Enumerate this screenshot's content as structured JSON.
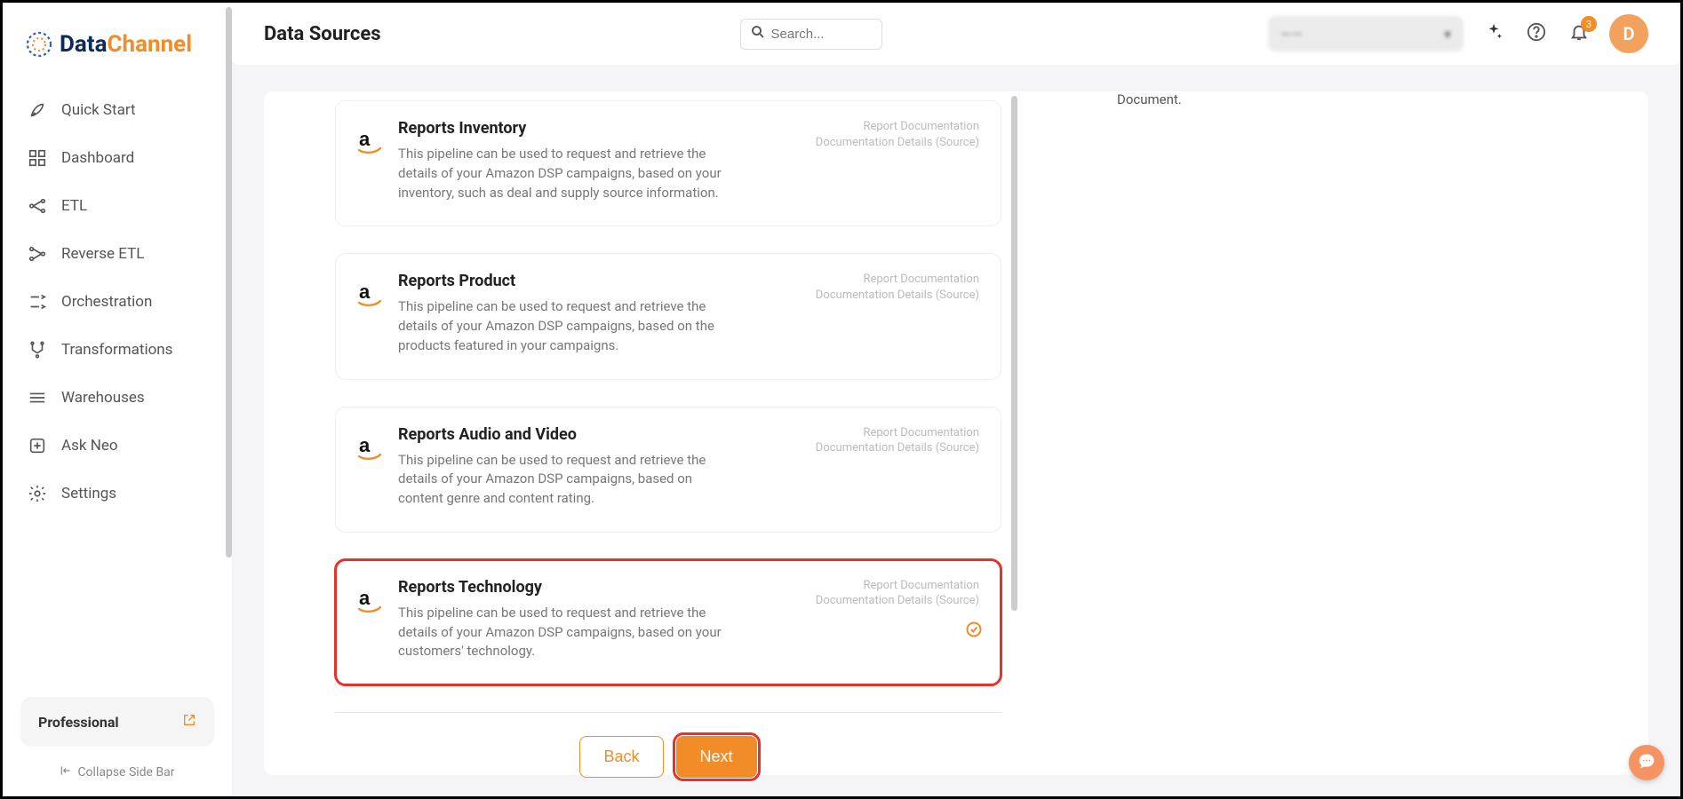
{
  "brand": {
    "data": "Data",
    "channel": "Channel"
  },
  "sidebar": {
    "items": [
      {
        "label": "Quick Start"
      },
      {
        "label": "Dashboard"
      },
      {
        "label": "ETL"
      },
      {
        "label": "Reverse ETL"
      },
      {
        "label": "Orchestration"
      },
      {
        "label": "Transformations"
      },
      {
        "label": "Warehouses"
      },
      {
        "label": "Ask Neo"
      },
      {
        "label": "Settings"
      }
    ],
    "plan": "Professional",
    "collapse": "Collapse Side Bar"
  },
  "header": {
    "title": "Data Sources",
    "search_placeholder": "Search...",
    "selector_label": "——",
    "badge_count": "3",
    "avatar_letter": "D"
  },
  "right_panel": {
    "text": "Document."
  },
  "cards": [
    {
      "title": "Reports Inventory",
      "desc": "This pipeline can be used to request and retrieve the details of your Amazon DSP campaigns, based on your inventory, such as deal and supply source information.",
      "link1": "Report Documentation",
      "link2": "Documentation Details (Source)",
      "selected": false
    },
    {
      "title": "Reports Product",
      "desc": "This pipeline can be used to request and retrieve the details of your Amazon DSP campaigns, based on the products featured in your campaigns.",
      "link1": "Report Documentation",
      "link2": "Documentation Details (Source)",
      "selected": false
    },
    {
      "title": "Reports Audio and Video",
      "desc": "This pipeline can be used to request and retrieve the details of your Amazon DSP campaigns, based on content genre and content rating.",
      "link1": "Report Documentation",
      "link2": "Documentation Details (Source)",
      "selected": false
    },
    {
      "title": "Reports Technology",
      "desc": "This pipeline can be used to request and retrieve the details of your Amazon DSP campaigns, based on your customers' technology.",
      "link1": "Report Documentation",
      "link2": "Documentation Details (Source)",
      "selected": true
    }
  ],
  "buttons": {
    "back": "Back",
    "next": "Next"
  }
}
